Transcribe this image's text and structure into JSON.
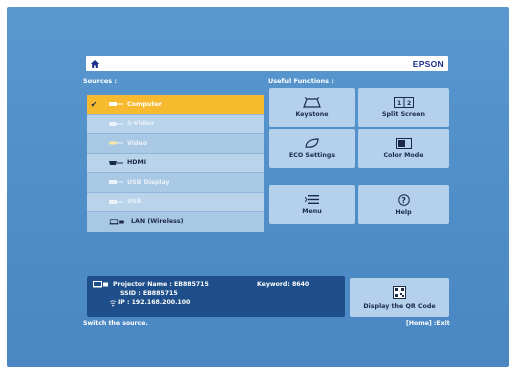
{
  "header": {
    "brand": "EPSON",
    "home_icon": "home-icon"
  },
  "sources": {
    "title": "Sources :",
    "items": [
      {
        "label": "Computer",
        "icon": "computer-icon",
        "state": "selected"
      },
      {
        "label": "S-Video",
        "icon": "svideo-icon",
        "state": "disabled"
      },
      {
        "label": "Video",
        "icon": "video-icon",
        "state": "disabled"
      },
      {
        "label": "HDMI",
        "icon": "hdmi-icon",
        "state": "enabled"
      },
      {
        "label": "USB Display",
        "icon": "usb-display-icon",
        "state": "disabled"
      },
      {
        "label": "USB",
        "icon": "usb-icon",
        "state": "disabled"
      },
      {
        "label": "LAN (Wireless)",
        "icon": "lan-icon",
        "state": "enabled"
      }
    ]
  },
  "functions": {
    "title": "Useful Functions :",
    "keystone": "Keystone",
    "split_screen": "Split Screen",
    "eco_settings": "ECO Settings",
    "color_mode": "Color Mode",
    "menu": "Menu",
    "help": "Help"
  },
  "info": {
    "projector_name": "Projector Name : EB885715",
    "ssid": "SSID : EB885715",
    "ip": "IP : 192.168.200.100",
    "keyword": "Keyword: 8640",
    "qr_label": "Display the QR Code"
  },
  "status": {
    "hint": "Switch the source.",
    "exit": "[Home] :Exit"
  },
  "colors": {
    "selected": "#f7ba2f",
    "tile": "#b4d0ea",
    "background": "#5a97cf",
    "info_panel": "#1e4f8a"
  }
}
